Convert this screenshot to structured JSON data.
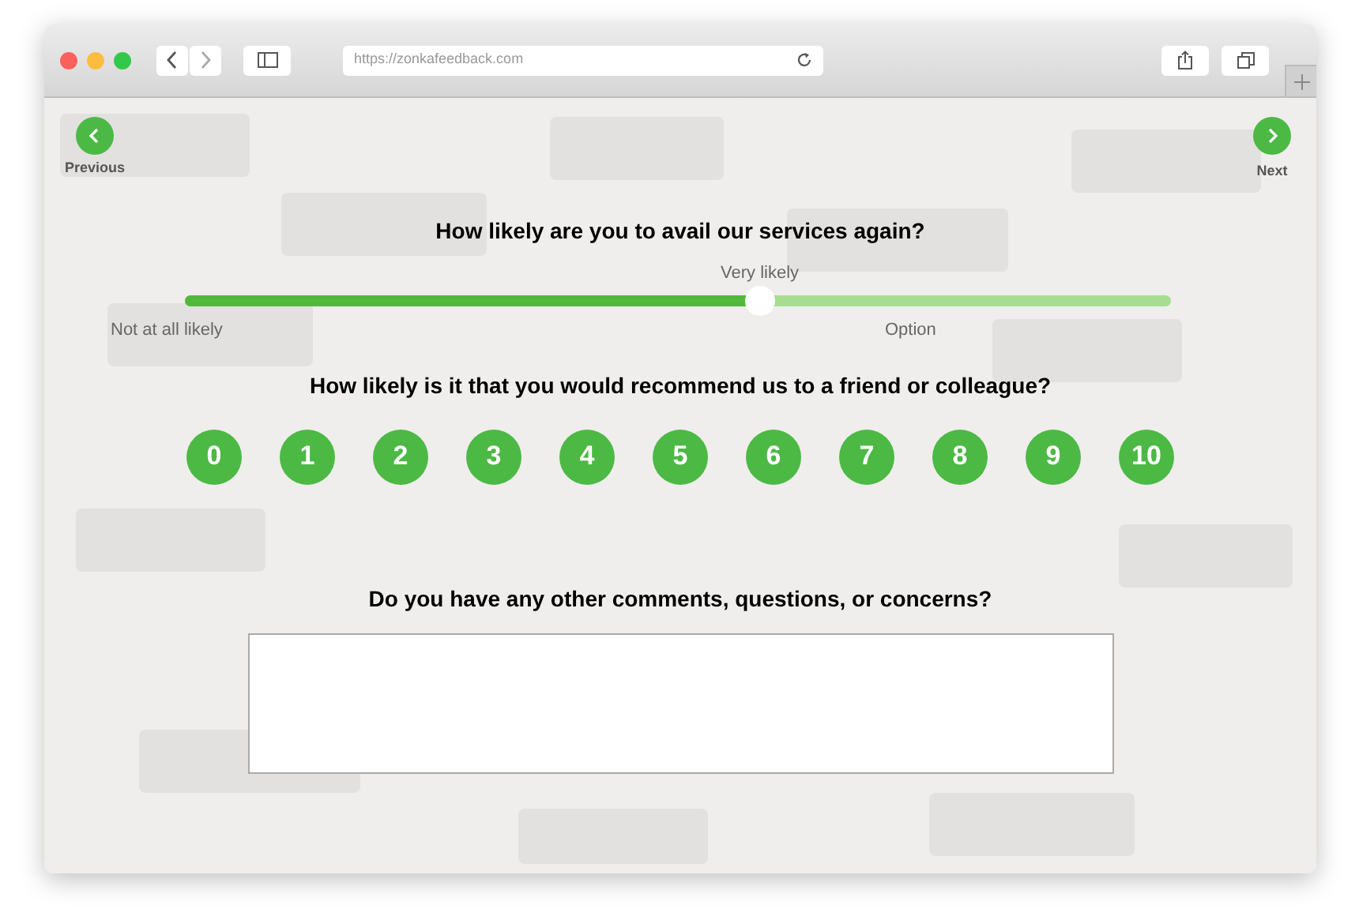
{
  "browser": {
    "url": "https://zonkafeedback.com"
  },
  "nav": {
    "previous": "Previous",
    "next": "Next"
  },
  "questions": [
    {
      "kind": "slider",
      "title": "How likely are you to avail our services again?",
      "value_label": "Very likely",
      "min_label": "Not at all likely",
      "max_label": "Option",
      "level": 0.583
    },
    {
      "kind": "nps",
      "title": "How likely is it that you would recommend us to a friend or colleague?",
      "options": [
        "0",
        "1",
        "2",
        "3",
        "4",
        "5",
        "6",
        "7",
        "8",
        "9",
        "10"
      ]
    },
    {
      "kind": "comment",
      "title": "Do you have any other comments, questions, or concerns?"
    }
  ]
}
